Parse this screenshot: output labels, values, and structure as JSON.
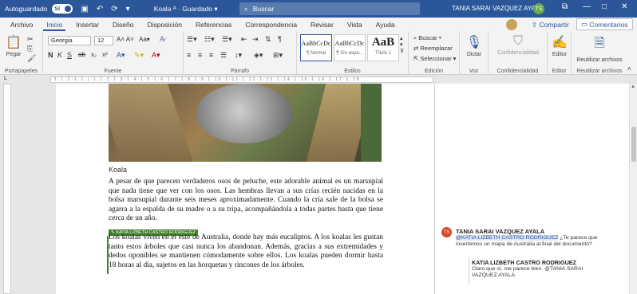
{
  "titlebar": {
    "autosave_label": "Autoguardado",
    "autosave_state": "Sí",
    "doc_title": "Koala",
    "save_status": "Guardado",
    "search_placeholder": "Buscar",
    "user_name": "TANIA SARAI VAZQUEZ AYALA",
    "user_initials": "TS",
    "window_buttons": [
      "restore-icon",
      "minimize-icon",
      "maximize-icon",
      "close-icon"
    ]
  },
  "tabs": [
    "Archivo",
    "Inicio",
    "Insertar",
    "Diseño",
    "Disposición",
    "Referencias",
    "Correspondencia",
    "Revisar",
    "Vista",
    "Ayuda"
  ],
  "active_tab": "Inicio",
  "share_label": "Compartir",
  "comments_label": "Comentarios",
  "ribbon": {
    "clipboard": {
      "label": "Portapapeles",
      "paste": "Pegar"
    },
    "font": {
      "label": "Fuente",
      "family": "Georgia",
      "size": "12"
    },
    "paragraph": {
      "label": "Párrafo"
    },
    "styles": {
      "label": "Estilos",
      "items": [
        {
          "preview": "AaBbCcDc",
          "name": "¶ Normal"
        },
        {
          "preview": "AaBbCcDc",
          "name": "¶ Sin espa..."
        },
        {
          "preview": "AaB",
          "name": "Título 1"
        }
      ]
    },
    "editing": {
      "label": "Edición",
      "find": "Buscar",
      "replace": "Reemplazar",
      "select": "Seleccionar"
    },
    "voice": {
      "label": "Voz",
      "dictate": "Dictar"
    },
    "sensitivity": {
      "label": "Confidencialidad",
      "button": "Confidencialidad"
    },
    "editor": {
      "label": "Editor",
      "button": "Editor"
    },
    "reuse": {
      "label": "Reutilizar archivos",
      "button": "Reutilizar archivos"
    }
  },
  "document": {
    "caption": "Koala",
    "para1": "A pesar de que parecen verdaderos osos de peluche, este adorable animal es un marsupial que nada tiene que ver con los osos. Las hembras llevan a sus crías recién nacidas en la bolsa marsupial durante seis meses aproximadamente. Cuando la cría sale de la bolsa se agarra a la espalda de su madre o a su tripa, acompañándola a todas partes hasta que tiene cerca de un año.",
    "author_tag": "KATIA LIZBETH CASTRO RODRIGUEZ",
    "para2": "Los koalas viven en el este de Australia, donde hay más eucaliptos. A los koalas les gustan tanto estos árboles que casi nunca los abandonan. Además, gracias a sus extremidades y dedos oponibles se mantienen cómodamente sobre ellos. Los koalas pueden dormir hasta 18 horas al día, sujetos en las horquetas y rincones de los árboles."
  },
  "comment": {
    "initials": "TS",
    "author": "TANIA SARAI VAZQUEZ AYALA",
    "mention": "@KATIA LIZBETH CASTRO RODRIGUEZ",
    "text": "¿Te parece que insertemos un mapa de Australia al final del documento?",
    "reply_author": "KATIA LIZBETH CASTRO RODRIGUEZ",
    "reply_text": "Claro que sí, me parece bien. @TANIA SARAI VAZQUEZ AYALA"
  }
}
